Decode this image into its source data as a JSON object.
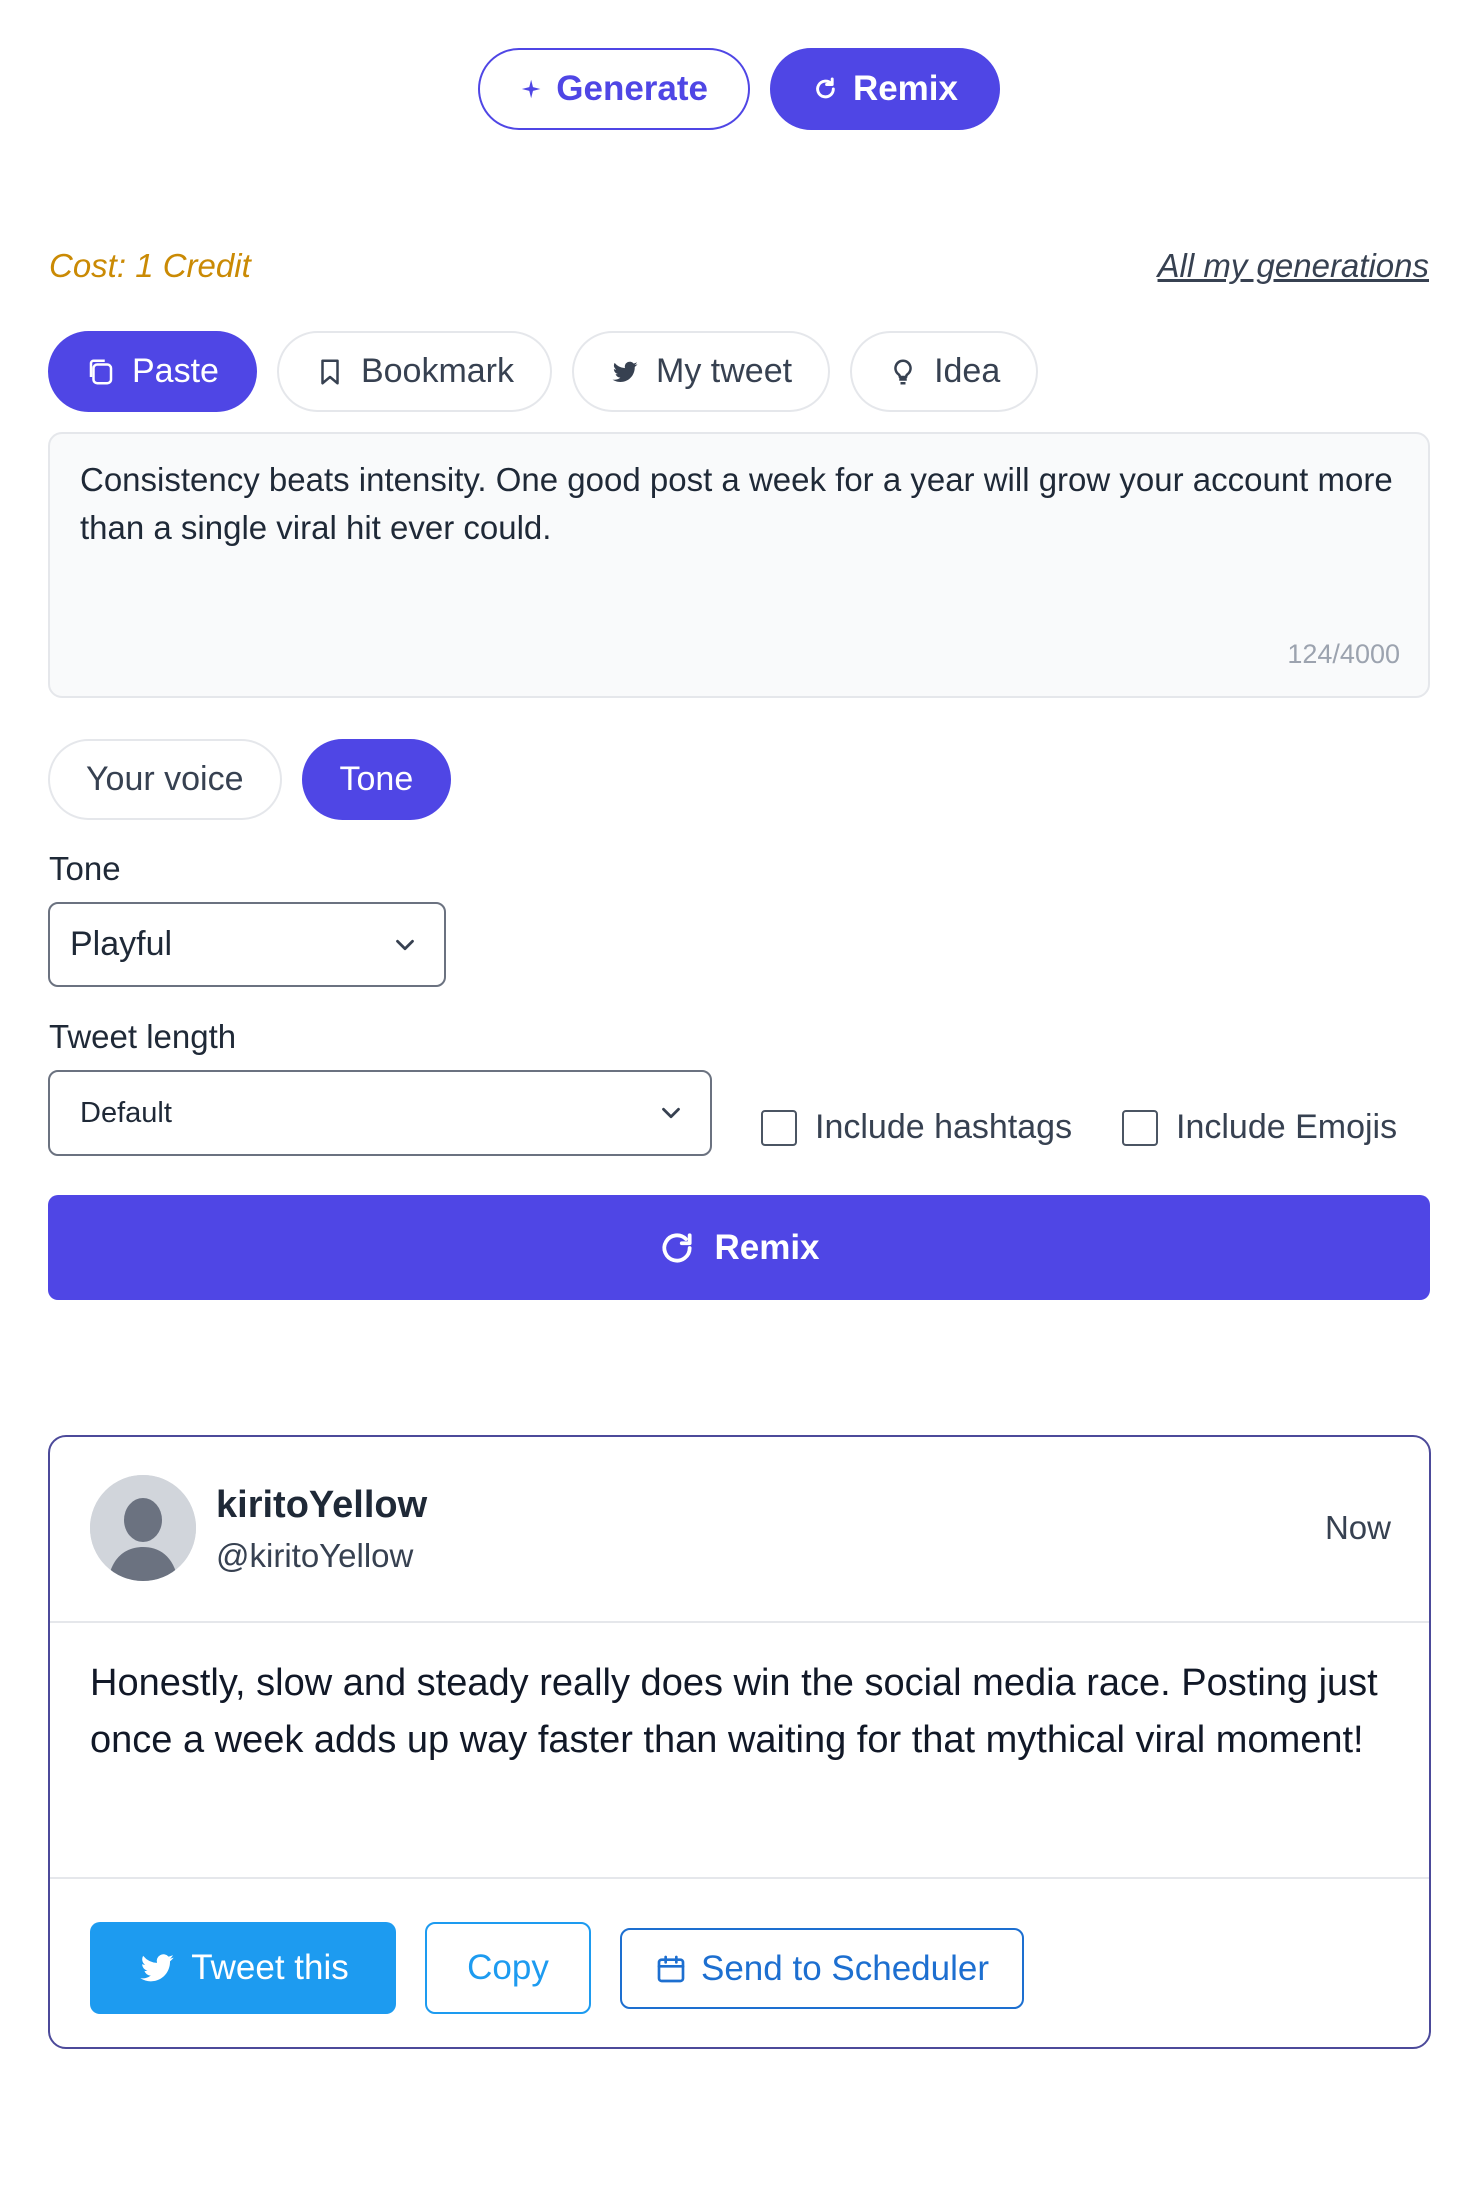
{
  "mode": {
    "generate_label": "Generate",
    "remix_label": "Remix"
  },
  "cost_label": "Cost: 1 Credit",
  "all_generations_label": "All my generations",
  "source_tabs": [
    {
      "label": "Paste",
      "icon": "copy-icon",
      "active": true
    },
    {
      "label": "Bookmark",
      "icon": "bookmark-icon",
      "active": false
    },
    {
      "label": "My tweet",
      "icon": "twitter-bird-icon",
      "active": false
    },
    {
      "label": "Idea",
      "icon": "lightbulb-icon",
      "active": false
    }
  ],
  "input": {
    "value": "Consistency beats intensity. One good post a week for a year will grow your account more than a single viral hit ever could.",
    "counter": "124/4000"
  },
  "style_tabs": [
    {
      "label": "Your voice",
      "active": false
    },
    {
      "label": "Tone",
      "active": true
    }
  ],
  "tone": {
    "label": "Tone",
    "selected": "Playful"
  },
  "length": {
    "label": "Tweet length",
    "selected": "Default"
  },
  "options": {
    "hashtags_label": "Include hashtags",
    "hashtags_checked": false,
    "emojis_label": "Include Emojis",
    "emojis_checked": false
  },
  "remix_button_label": "Remix",
  "tweet": {
    "username": "kiritoYellow",
    "handle": "@kiritoYellow",
    "time": "Now",
    "text": "Honestly, slow and steady really does win the social media race. Posting just once a week adds up way faster than waiting for that mythical viral moment!",
    "tweet_label": "Tweet this",
    "copy_label": "Copy",
    "scheduler_label": "Send to Scheduler"
  },
  "colors": {
    "accent": "#4f46e5",
    "twitter": "#1d9bf0",
    "cost": "#ca8a04"
  }
}
